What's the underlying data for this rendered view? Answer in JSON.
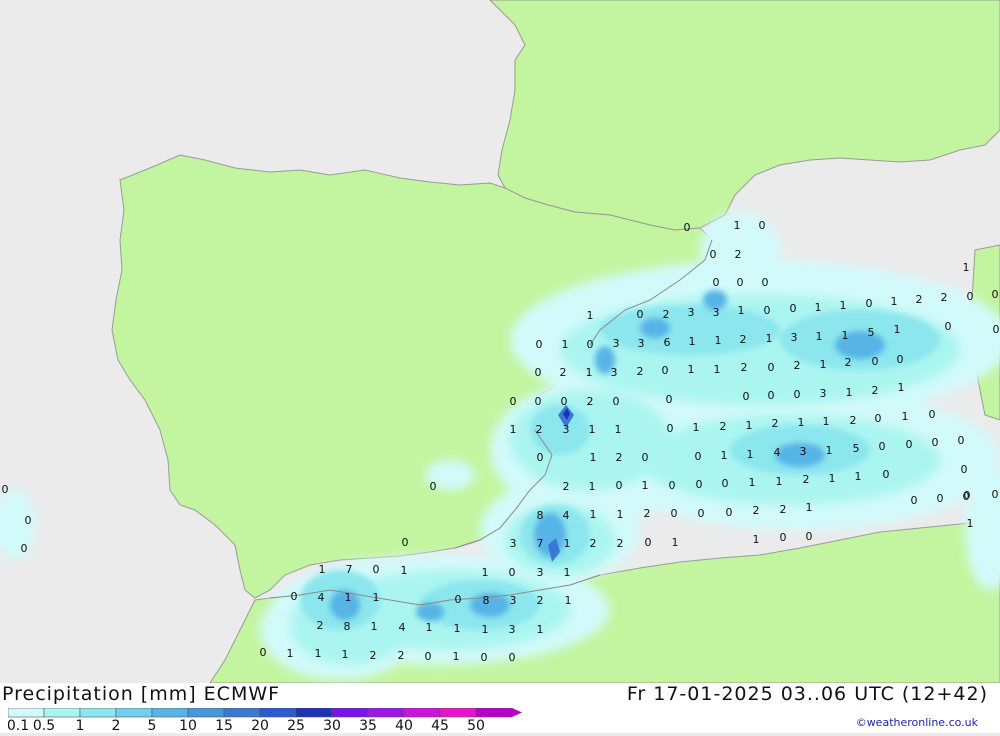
{
  "header": {
    "product": "Precipitation [mm] ECMWF",
    "valid_time": "Fr 17-01-2025 03..06 UTC (12+42)",
    "credit": "©weatheronline.co.uk"
  },
  "legend": {
    "levels": [
      "0.1",
      "0.5",
      "1",
      "2",
      "5",
      "10",
      "15",
      "20",
      "25",
      "30",
      "35",
      "40",
      "45",
      "50"
    ],
    "colors": [
      "#d2fafa",
      "#aaf5f0",
      "#8ce6ee",
      "#6ed2ec",
      "#56b4e6",
      "#4696e0",
      "#3a78d8",
      "#2e5ad0",
      "#1e32b4",
      "#7814e6",
      "#a014e6",
      "#c814dc",
      "#e614d2",
      "#b400c8"
    ]
  },
  "map_colors": {
    "sea": "#ebebeb",
    "land": "#c3f5a0",
    "coast": "#9a9a9a"
  },
  "values": [
    {
      "t": "0"
    },
    {
      "t": "1"
    },
    {
      "t": "0"
    },
    {
      "t": "0"
    },
    {
      "t": "2"
    },
    {
      "t": "1"
    },
    {
      "t": "0"
    },
    {
      "t": "0"
    },
    {
      "t": "0"
    },
    {
      "t": "0"
    },
    {
      "t": "1"
    },
    {
      "t": "0"
    },
    {
      "t": "2"
    },
    {
      "t": "3"
    },
    {
      "t": "3"
    },
    {
      "t": "1"
    },
    {
      "t": "0"
    },
    {
      "t": "0"
    },
    {
      "t": "1"
    },
    {
      "t": "1"
    },
    {
      "t": "0"
    },
    {
      "t": "1"
    },
    {
      "t": "2"
    },
    {
      "t": "2"
    },
    {
      "t": "0"
    },
    {
      "t": "0"
    },
    {
      "t": "0"
    },
    {
      "t": "1"
    },
    {
      "t": "0"
    },
    {
      "t": "3"
    },
    {
      "t": "3"
    },
    {
      "t": "6"
    },
    {
      "t": "1"
    },
    {
      "t": "1"
    },
    {
      "t": "2"
    },
    {
      "t": "1"
    },
    {
      "t": "3"
    },
    {
      "t": "1"
    },
    {
      "t": "1"
    },
    {
      "t": "5"
    },
    {
      "t": "1"
    },
    {
      "t": "0"
    },
    {
      "t": "0"
    },
    {
      "t": "2"
    },
    {
      "t": "1"
    },
    {
      "t": "3"
    },
    {
      "t": "2"
    },
    {
      "t": "0"
    },
    {
      "t": "1"
    },
    {
      "t": "1"
    },
    {
      "t": "2"
    },
    {
      "t": "0"
    },
    {
      "t": "2"
    },
    {
      "t": "1"
    },
    {
      "t": "2"
    },
    {
      "t": "0"
    },
    {
      "t": "0"
    },
    {
      "t": "0"
    },
    {
      "t": "0"
    },
    {
      "t": "0"
    },
    {
      "t": "2"
    },
    {
      "t": "0"
    },
    {
      "t": "0"
    },
    {
      "t": "0"
    },
    {
      "t": "0"
    },
    {
      "t": "0"
    },
    {
      "t": "3"
    },
    {
      "t": "1"
    },
    {
      "t": "2"
    },
    {
      "t": "1"
    },
    {
      "t": "1"
    },
    {
      "t": "2"
    },
    {
      "t": "3"
    },
    {
      "t": "1"
    },
    {
      "t": "1"
    },
    {
      "t": "0"
    },
    {
      "t": "1"
    },
    {
      "t": "2"
    },
    {
      "t": "1"
    },
    {
      "t": "2"
    },
    {
      "t": "1"
    },
    {
      "t": "1"
    },
    {
      "t": "2"
    },
    {
      "t": "0"
    },
    {
      "t": "1"
    },
    {
      "t": "0"
    },
    {
      "t": "0"
    },
    {
      "t": "1"
    },
    {
      "t": "2"
    },
    {
      "t": "0"
    },
    {
      "t": "0"
    },
    {
      "t": "1"
    },
    {
      "t": "1"
    },
    {
      "t": "4"
    },
    {
      "t": "3"
    },
    {
      "t": "1"
    },
    {
      "t": "5"
    },
    {
      "t": "0"
    },
    {
      "t": "0"
    },
    {
      "t": "0"
    },
    {
      "t": "0"
    },
    {
      "t": "0"
    },
    {
      "t": "0"
    },
    {
      "t": "2"
    },
    {
      "t": "1"
    },
    {
      "t": "0"
    },
    {
      "t": "1"
    },
    {
      "t": "0"
    },
    {
      "t": "0"
    },
    {
      "t": "0"
    },
    {
      "t": "1"
    },
    {
      "t": "1"
    },
    {
      "t": "2"
    },
    {
      "t": "1"
    },
    {
      "t": "1"
    },
    {
      "t": "0"
    },
    {
      "t": "0"
    },
    {
      "t": "0"
    },
    {
      "t": "8"
    },
    {
      "t": "4"
    },
    {
      "t": "1"
    },
    {
      "t": "1"
    },
    {
      "t": "2"
    },
    {
      "t": "0"
    },
    {
      "t": "0"
    },
    {
      "t": "0"
    },
    {
      "t": "2"
    },
    {
      "t": "2"
    },
    {
      "t": "1"
    },
    {
      "t": "0"
    },
    {
      "t": "0"
    },
    {
      "t": "0"
    },
    {
      "t": "0"
    },
    {
      "t": "1"
    },
    {
      "t": "0"
    },
    {
      "t": "0"
    },
    {
      "t": "3"
    },
    {
      "t": "7"
    },
    {
      "t": "1"
    },
    {
      "t": "2"
    },
    {
      "t": "2"
    },
    {
      "t": "0"
    },
    {
      "t": "1"
    },
    {
      "t": "1"
    },
    {
      "t": "0"
    },
    {
      "t": "0"
    },
    {
      "t": "1"
    },
    {
      "t": "7"
    },
    {
      "t": "0"
    },
    {
      "t": "1"
    },
    {
      "t": "0"
    },
    {
      "t": "1"
    },
    {
      "t": "0"
    },
    {
      "t": "3"
    },
    {
      "t": "1"
    },
    {
      "t": "0"
    },
    {
      "t": "4"
    },
    {
      "t": "1"
    },
    {
      "t": "1"
    },
    {
      "t": "0"
    },
    {
      "t": "8"
    },
    {
      "t": "3"
    },
    {
      "t": "2"
    },
    {
      "t": "1"
    },
    {
      "t": "2"
    },
    {
      "t": "8"
    },
    {
      "t": "1"
    },
    {
      "t": "4"
    },
    {
      "t": "1"
    },
    {
      "t": "1"
    },
    {
      "t": "1"
    },
    {
      "t": "3"
    },
    {
      "t": "1"
    },
    {
      "t": "0"
    },
    {
      "t": "1"
    },
    {
      "t": "1"
    },
    {
      "t": "1"
    },
    {
      "t": "2"
    },
    {
      "t": "2"
    },
    {
      "t": "0"
    },
    {
      "t": "1"
    },
    {
      "t": "0"
    },
    {
      "t": "0"
    }
  ]
}
